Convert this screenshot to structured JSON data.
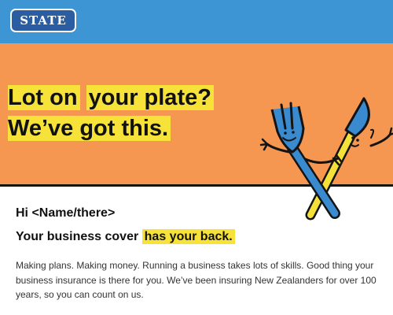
{
  "brand": {
    "logo_text": "STATE",
    "color": "#2b5da3"
  },
  "colors": {
    "header": "#3d95d4",
    "hero": "#f59651",
    "highlight": "#f7e23a",
    "fork": "#3a8ad0",
    "knife": "#f3e13a"
  },
  "hero": {
    "headline_line1_a": "Lot on",
    "headline_line1_b": "your plate?",
    "headline_line2": "We’ve got this.",
    "illustration": "fork-and-knife-icon"
  },
  "email": {
    "greeting": "Hi <Name/there>",
    "subhead_a": "Your business cover ",
    "subhead_b": "has your back.",
    "body": "Making plans. Making money. Running a business takes lots of skills. Good thing your business insurance is there for you. We’ve been insuring New Zealanders for over 100 years, so you can count on us."
  }
}
